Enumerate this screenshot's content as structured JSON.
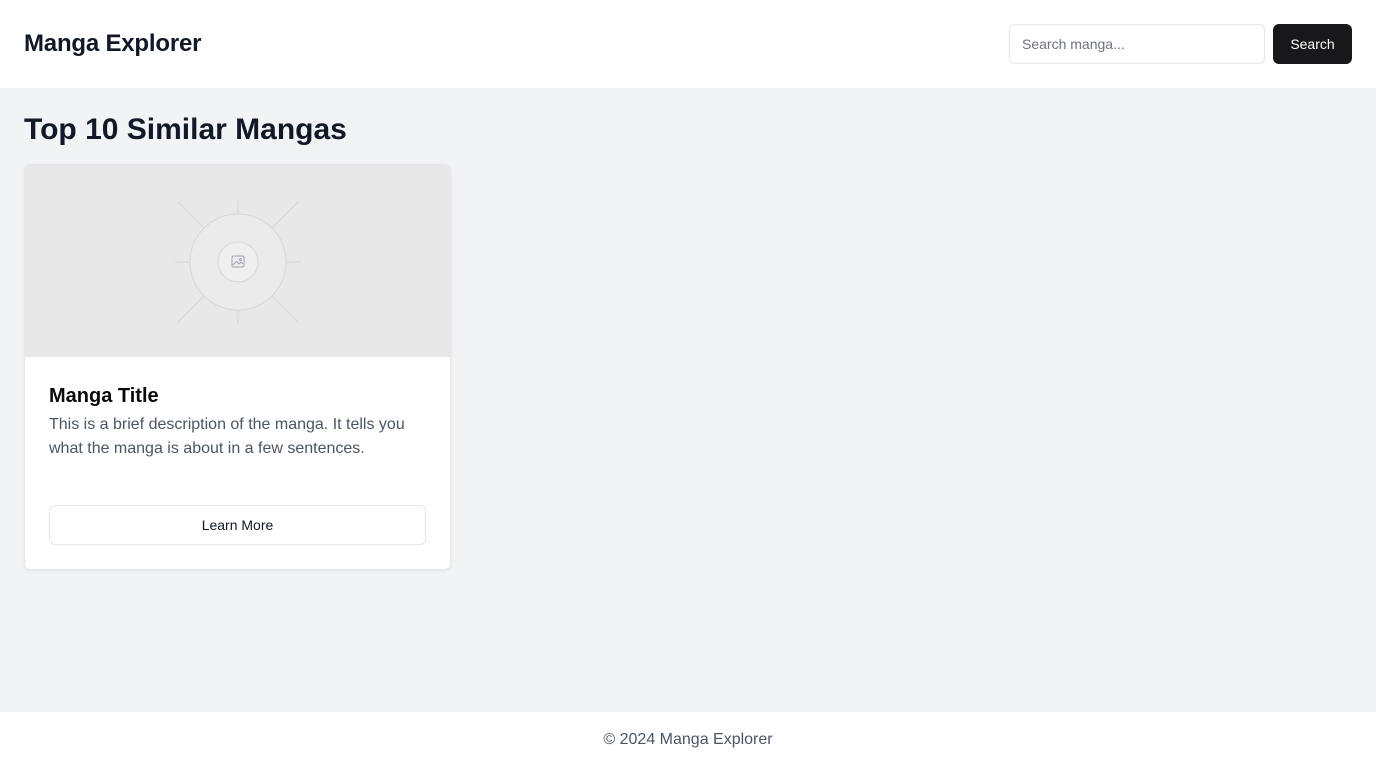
{
  "header": {
    "brand": "Manga Explorer",
    "search_placeholder": "Search manga...",
    "search_button": "Search"
  },
  "main": {
    "title": "Top 10 Similar Mangas",
    "cards": [
      {
        "title": "Manga Title",
        "description": "This is a brief description of the manga. It tells you what the manga is about in a few sentences.",
        "button": "Learn More",
        "image_icon": "image-placeholder-icon"
      }
    ]
  },
  "footer": {
    "text": "© 2024 Manga Explorer"
  }
}
